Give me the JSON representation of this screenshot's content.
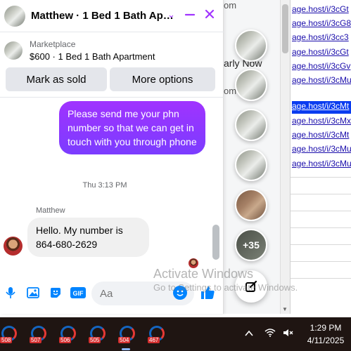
{
  "background": {
    "com_1": "om",
    "early_now": "arly Now",
    "com_2": "om"
  },
  "links": [
    "age.host/i/3cGt",
    "age.host/i/3cG8",
    "age.host/i/3cc3",
    "age.host/i/3cGt",
    "age.host/i/3cGv",
    "age.host/i/3cMu",
    "age.host/i/3cMt",
    "age.host/i/3cMx",
    "age.host/i/3cMt",
    "age.host/i/3cMu",
    "age.host/i/3cMu"
  ],
  "selected_link_index": 6,
  "chat": {
    "title": "Matthew · 1 Bed 1 Bath Ap…",
    "marketplace_label": "Marketplace",
    "listing": "$600 · 1 Bed 1 Bath Apartment",
    "mark_sold": "Mark as sold",
    "more_options": "More options",
    "outgoing": "Please send me your phn number so that we can get in touch with you through phone",
    "timestamp": "Thu 3:13 PM",
    "sender": "Matthew",
    "incoming": "Hello. My number is 864-680-2629",
    "input_placeholder": "Aa",
    "accent_color": "#a033ff"
  },
  "bubbles": {
    "more_count": "+35"
  },
  "watermark": {
    "line1": "Activate Windows",
    "line2": "Go to Settings to activate Windows."
  },
  "taskbar": {
    "badges": [
      "508",
      "507",
      "506",
      "505",
      "504",
      "467"
    ],
    "time": "1:29 PM",
    "date": "4/11/2025"
  }
}
